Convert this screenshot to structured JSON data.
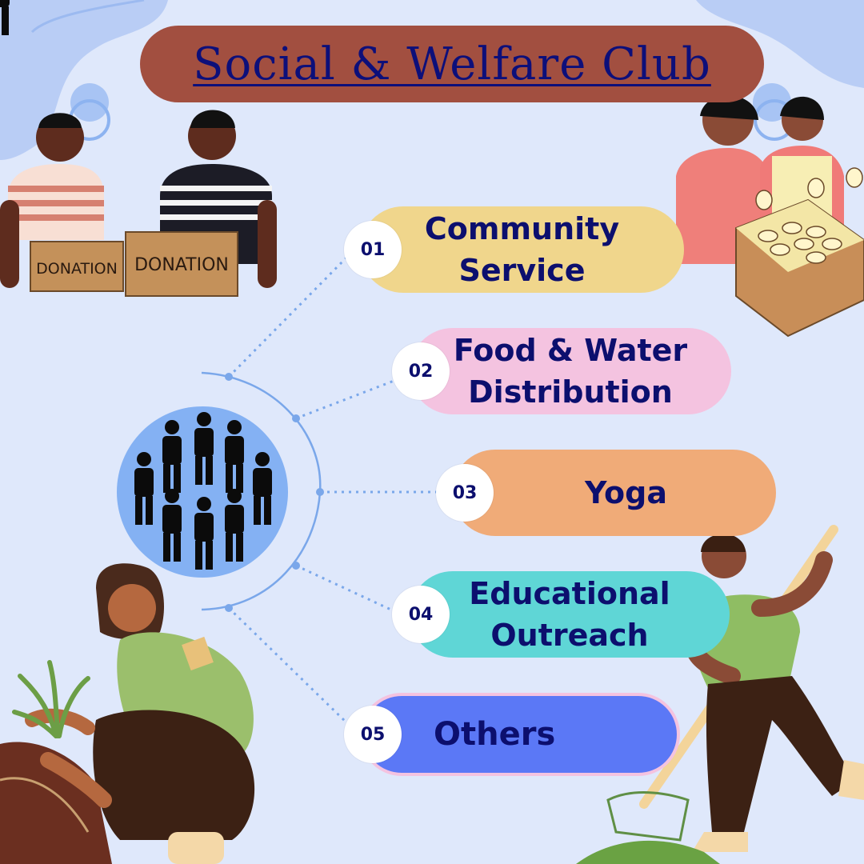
{
  "title": "Social & Welfare Club",
  "colors": {
    "background": "#dfe8fb",
    "title_pill": "#a24f40",
    "title_text": "#0d0f7a",
    "text": "#0c0f6e",
    "connector": "#7aa7ea",
    "hub": "#84b1f3"
  },
  "items": [
    {
      "number": "01",
      "label": "Community\nService",
      "color": "#f0d68c"
    },
    {
      "number": "02",
      "label": "Food & Water\nDistribution",
      "color": "#f4c3e0"
    },
    {
      "number": "03",
      "label": "Yoga",
      "color": "#f0ab78"
    },
    {
      "number": "04",
      "label": "Educational\nOutreach",
      "color": "#5fd6d6"
    },
    {
      "number": "05",
      "label": "Others",
      "color": "#5b78f6"
    }
  ],
  "illustrations": {
    "top_left_signs": [
      "DONATION",
      "DONATION"
    ],
    "hub_icon": "group-people-icon"
  }
}
